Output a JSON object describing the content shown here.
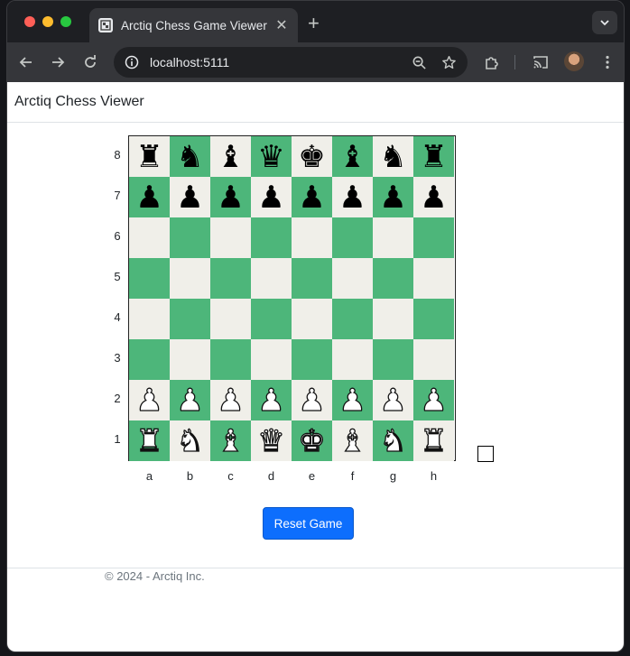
{
  "browser": {
    "tab_title": "Arctiq Chess Game Viewer",
    "tab_close": "✕",
    "new_tab": "+",
    "url": "localhost:5111"
  },
  "app": {
    "brand": "Arctiq Chess Viewer",
    "reset_label": "Reset Game",
    "footer": "© 2024 - Arctiq Inc."
  },
  "board": {
    "ranks": [
      "8",
      "7",
      "6",
      "5",
      "4",
      "3",
      "2",
      "1"
    ],
    "files": [
      "a",
      "b",
      "c",
      "d",
      "e",
      "f",
      "g",
      "h"
    ],
    "rows": [
      [
        "♜",
        "♞",
        "♝",
        "♛",
        "♚",
        "♝",
        "♞",
        "♜"
      ],
      [
        "♟",
        "♟",
        "♟",
        "♟",
        "♟",
        "♟",
        "♟",
        "♟"
      ],
      [
        "",
        "",
        "",
        "",
        "",
        "",
        "",
        ""
      ],
      [
        "",
        "",
        "",
        "",
        "",
        "",
        "",
        ""
      ],
      [
        "",
        "",
        "",
        "",
        "",
        "",
        "",
        ""
      ],
      [
        "",
        "",
        "",
        "",
        "",
        "",
        "",
        ""
      ],
      [
        "♟",
        "♟",
        "♟",
        "♟",
        "♟",
        "♟",
        "♟",
        "♟"
      ],
      [
        "♜",
        "♞",
        "♝",
        "♛",
        "♚",
        "♝",
        "♞",
        "♜"
      ]
    ],
    "piece_colors": [
      [
        "b",
        "b",
        "b",
        "b",
        "b",
        "b",
        "b",
        "b"
      ],
      [
        "b",
        "b",
        "b",
        "b",
        "b",
        "b",
        "b",
        "b"
      ],
      [
        "",
        "",
        "",
        "",
        "",
        "",
        "",
        ""
      ],
      [
        "",
        "",
        "",
        "",
        "",
        "",
        "",
        ""
      ],
      [
        "",
        "",
        "",
        "",
        "",
        "",
        "",
        ""
      ],
      [
        "",
        "",
        "",
        "",
        "",
        "",
        "",
        ""
      ],
      [
        "w",
        "w",
        "w",
        "w",
        "w",
        "w",
        "w",
        "w"
      ],
      [
        "w",
        "w",
        "w",
        "w",
        "w",
        "w",
        "w",
        "w"
      ]
    ],
    "light_color": "#f0efe9",
    "dark_color": "#4db67a"
  }
}
